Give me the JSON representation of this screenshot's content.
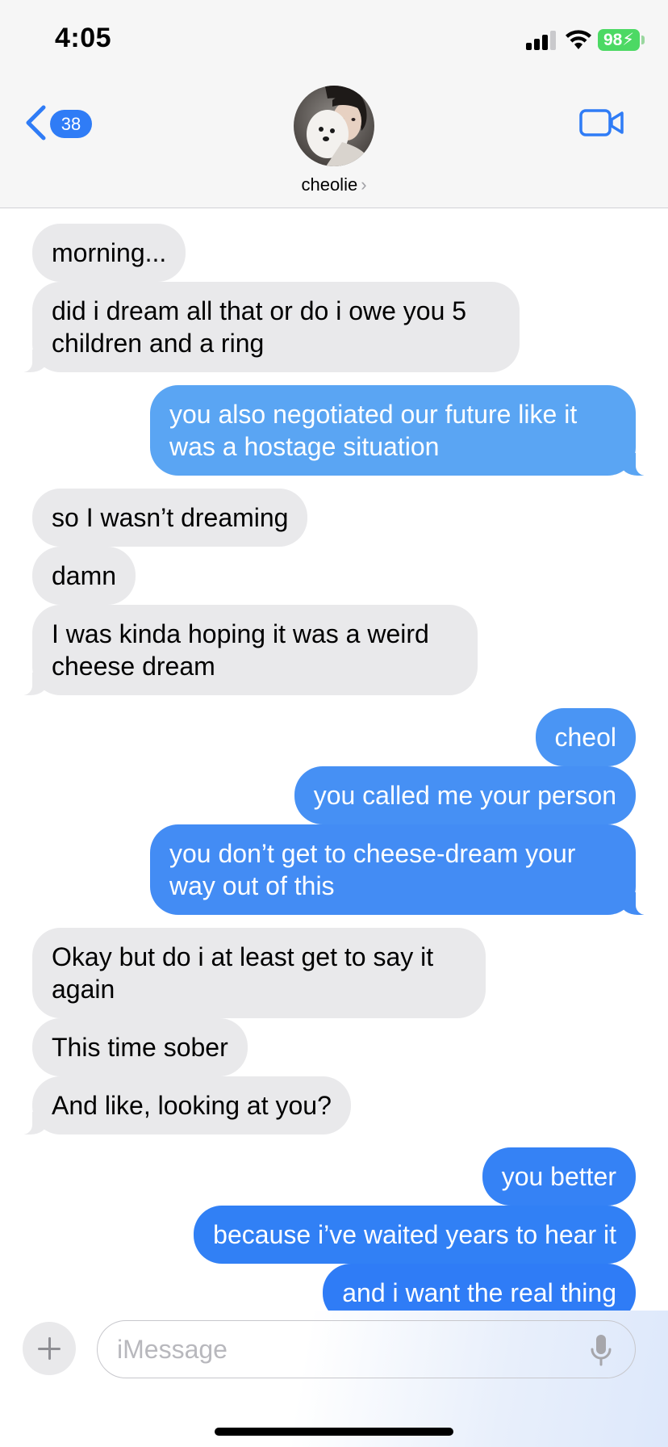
{
  "status_bar": {
    "time": "4:05",
    "battery": "98",
    "icons": [
      "cellular-signal-icon",
      "wifi-icon",
      "battery-charging-icon"
    ]
  },
  "header": {
    "back_badge_count": "38",
    "contact_name": "cheolie",
    "name_chevron": "›",
    "icons": [
      "chevron-left-icon",
      "video-camera-icon"
    ]
  },
  "colors": {
    "incoming": "#e9e9eb",
    "outgoing_top": "#5aa5f3",
    "outgoing_bottom": "#2f7cf6",
    "accent": "#2f7cf6"
  },
  "messages": [
    {
      "direction": "incoming",
      "text": "morning..."
    },
    {
      "direction": "incoming",
      "text": "did i dream all that or do i owe you 5 children and a ring"
    },
    {
      "direction": "outgoing",
      "text": "you also negotiated our future like it was a hostage situation"
    },
    {
      "direction": "incoming",
      "text": "so I wasn’t dreaming"
    },
    {
      "direction": "incoming",
      "text": "damn"
    },
    {
      "direction": "incoming",
      "text": "I was kinda hoping it was a weird cheese dream"
    },
    {
      "direction": "outgoing",
      "text": "cheol"
    },
    {
      "direction": "outgoing",
      "text": "you called me your person"
    },
    {
      "direction": "outgoing",
      "text": "you don’t get to cheese-dream your way out of this"
    },
    {
      "direction": "incoming",
      "text": "Okay but do i at least get to say it again"
    },
    {
      "direction": "incoming",
      "text": "This time sober"
    },
    {
      "direction": "incoming",
      "text": "And like, looking at you?"
    },
    {
      "direction": "outgoing",
      "text": "you better"
    },
    {
      "direction": "outgoing",
      "text": "because i’ve waited years to hear it"
    },
    {
      "direction": "outgoing",
      "text": "and i want the real thing"
    }
  ],
  "input_bar": {
    "placeholder": "iMessage",
    "value": "",
    "icons": [
      "plus-icon",
      "microphone-icon"
    ]
  }
}
